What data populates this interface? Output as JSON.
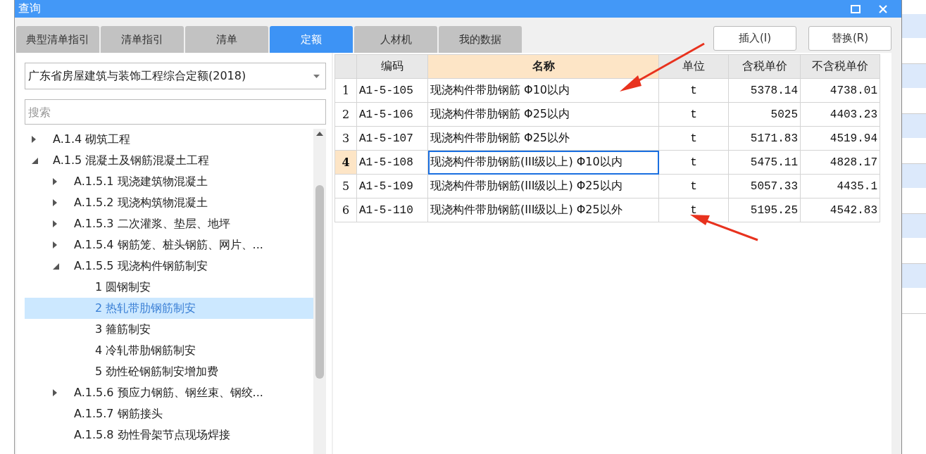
{
  "window": {
    "title": "查询"
  },
  "tabs": [
    {
      "label": "典型清单指引",
      "selected": false
    },
    {
      "label": "清单指引",
      "selected": false
    },
    {
      "label": "清单",
      "selected": false
    },
    {
      "label": "定额",
      "selected": true
    },
    {
      "label": "人材机",
      "selected": false
    },
    {
      "label": "我的数据",
      "selected": false
    }
  ],
  "buttons": [
    "插入(I)",
    "替换(R)"
  ],
  "library_select": {
    "value": "广东省房屋建筑与装饰工程综合定额(2018)"
  },
  "search": {
    "placeholder": "搜索"
  },
  "tree": [
    {
      "label": "A.1.4 砌筑工程",
      "expanded": false,
      "selected": false
    },
    {
      "label": "A.1.5 混凝土及钢筋混凝土工程",
      "expanded": true,
      "selected": false,
      "children": [
        {
          "label": "A.1.5.1 现浇建筑物混凝土",
          "expanded": false,
          "selected": false
        },
        {
          "label": "A.1.5.2 现浇构筑物混凝土",
          "expanded": false,
          "selected": false
        },
        {
          "label": "A.1.5.3 二次灌浆、垫层、地坪",
          "expanded": false,
          "selected": false
        },
        {
          "label": "A.1.5.4 钢筋笼、桩头钢筋、网片、...",
          "expanded": false,
          "selected": false
        },
        {
          "label": "A.1.5.5 现浇构件钢筋制安",
          "expanded": true,
          "selected": false,
          "children": [
            {
              "label": "1 圆钢制安",
              "selected": false
            },
            {
              "label": "2 热轧带肋钢筋制安",
              "selected": true
            },
            {
              "label": "3 箍筋制安",
              "selected": false
            },
            {
              "label": "4 冷轧带肋钢筋制安",
              "selected": false
            },
            {
              "label": "5 劲性砼钢筋制安增加费",
              "selected": false
            }
          ]
        },
        {
          "label": "A.1.5.6 预应力钢筋、钢丝束、钢绞...",
          "expanded": false,
          "selected": false
        },
        {
          "label": "A.1.5.7 钢筋接头",
          "selected": false
        },
        {
          "label": "A.1.5.8 劲性骨架节点现场焊接",
          "selected": false
        }
      ]
    }
  ],
  "table": {
    "columns": [
      {
        "label": "编码",
        "selected": false
      },
      {
        "label": "名称",
        "selected": true
      },
      {
        "label": "单位",
        "selected": false
      },
      {
        "label": "含税单价",
        "selected": false
      },
      {
        "label": "不含税单价",
        "selected": false
      }
    ],
    "rows": [
      {
        "index": "1",
        "selected": false,
        "cells": [
          "A1-5-105",
          "现浇构件带肋钢筋 Φ10以内",
          "t",
          "5378.14",
          "4738.01"
        ]
      },
      {
        "index": "2",
        "selected": false,
        "cells": [
          "A1-5-106",
          "现浇构件带肋钢筋 Φ25以内",
          "t",
          "5025",
          "4403.23"
        ]
      },
      {
        "index": "3",
        "selected": false,
        "cells": [
          "A1-5-107",
          "现浇构件带肋钢筋 Φ25以外",
          "t",
          "5171.83",
          "4519.94"
        ]
      },
      {
        "index": "4",
        "selected": true,
        "cells": [
          "A1-5-108",
          "现浇构件带肋钢筋(III级以上) Φ10以内",
          "t",
          "5475.11",
          "4828.17"
        ]
      },
      {
        "index": "5",
        "selected": false,
        "cells": [
          "A1-5-109",
          "现浇构件带肋钢筋(III级以上) Φ25以内",
          "t",
          "5057.33",
          "4435.1"
        ]
      },
      {
        "index": "6",
        "selected": false,
        "cells": [
          "A1-5-110",
          "现浇构件带肋钢筋(III级以上) Φ25以外",
          "t",
          "5195.25",
          "4542.83"
        ]
      }
    ]
  }
}
